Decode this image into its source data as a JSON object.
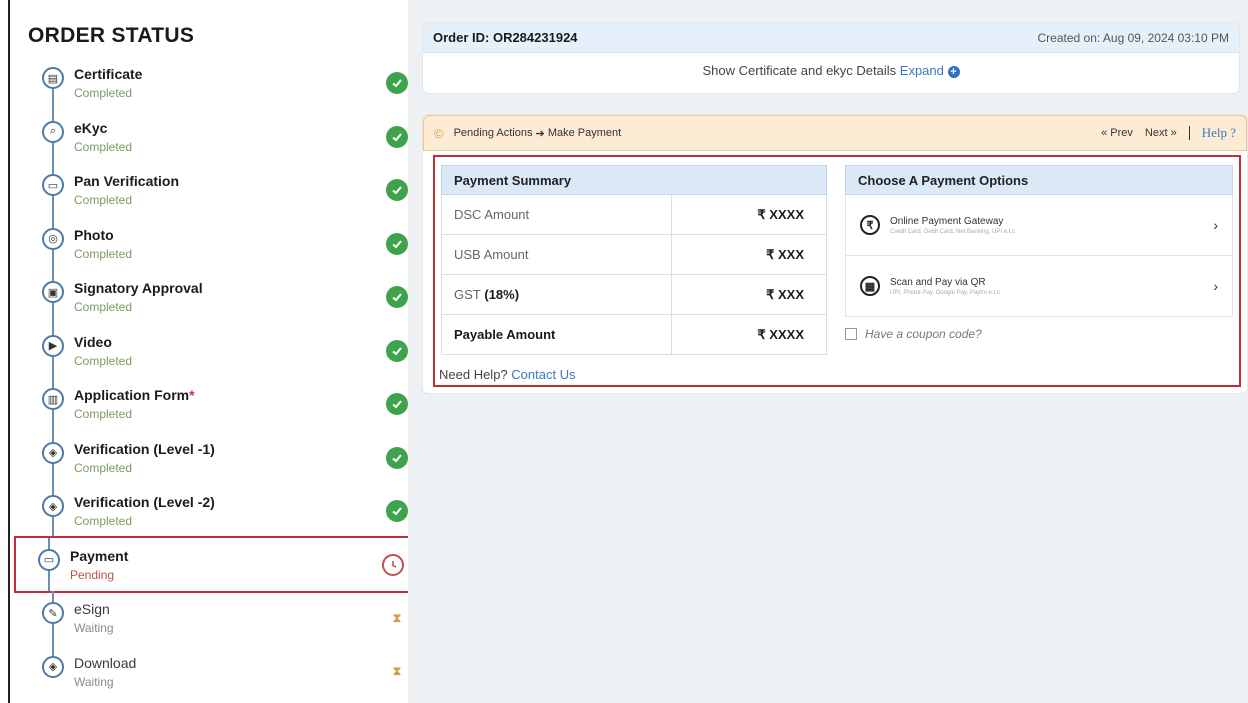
{
  "sidebar": {
    "title": "ORDER STATUS",
    "steps": [
      {
        "label": "Certificate",
        "status": "Completed",
        "state": "done",
        "icon": "certificate-icon"
      },
      {
        "label": "eKyc",
        "status": "Completed",
        "state": "done",
        "icon": "search-user-icon"
      },
      {
        "label": "Pan Verification",
        "status": "Completed",
        "state": "done",
        "icon": "card-icon"
      },
      {
        "label": "Photo",
        "status": "Completed",
        "state": "done",
        "icon": "photo-icon"
      },
      {
        "label": "Signatory Approval",
        "status": "Completed",
        "state": "done",
        "icon": "approval-icon"
      },
      {
        "label": "Video",
        "status": "Completed",
        "state": "done",
        "icon": "video-icon"
      },
      {
        "label": "Application Form",
        "status": "Completed",
        "state": "done",
        "icon": "form-icon",
        "required_mark": "*"
      },
      {
        "label": "Verification (Level -1)",
        "status": "Completed",
        "state": "done",
        "icon": "shield-icon"
      },
      {
        "label": "Verification (Level -2)",
        "status": "Completed",
        "state": "done",
        "icon": "shield-icon"
      },
      {
        "label": "Payment",
        "status": "Pending",
        "state": "pending",
        "icon": "card-icon"
      },
      {
        "label": "eSign",
        "status": "Waiting",
        "state": "waiting",
        "icon": "signature-icon"
      },
      {
        "label": "Download",
        "status": "Waiting",
        "state": "waiting",
        "icon": "shield-icon"
      }
    ]
  },
  "order": {
    "id_label": "Order ID: OR284231924",
    "created": "Created on: Aug 09, 2024 03:10 PM",
    "details_text": "Show Certificate and ekyc Details",
    "expand_label": "Expand"
  },
  "pending_bar": {
    "text": "Pending Actions",
    "arrow": "➔",
    "action": "Make Payment",
    "prev": "Prev",
    "next": "Next",
    "help": "Help ?"
  },
  "summary": {
    "title": "Payment Summary",
    "rows": [
      {
        "k": "DSC Amount",
        "v": "₹ XXXX"
      },
      {
        "k": "USB Amount",
        "v": "₹ XXX"
      },
      {
        "k": "GST",
        "k_bold": "(18%)",
        "v": "₹ XXX"
      },
      {
        "k": "Payable Amount",
        "v": "₹ XXXX"
      }
    ],
    "need_help": "Need Help?",
    "contact": "Contact Us"
  },
  "options": {
    "title": "Choose A Payment Options",
    "items": [
      {
        "title": "Online Payment Gateway",
        "sub": "Credit Card, Debit Card, Net Banking, UPI e.t.c"
      },
      {
        "title": "Scan and Pay via QR",
        "sub": "UPI, Phone Pay, Google Pay, Paytm e.t.c"
      }
    ],
    "coupon": "Have a coupon code?"
  },
  "colors": {
    "done": "#3fa34d",
    "pending": "#c0504d",
    "accent": "#3b78c4",
    "highlight": "#c0303a"
  }
}
